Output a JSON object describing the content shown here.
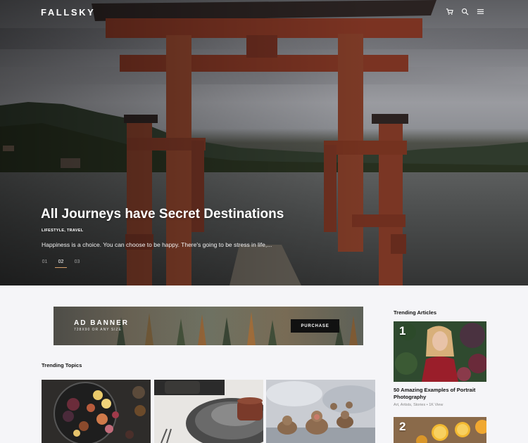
{
  "header": {
    "logo": "FALLSKY",
    "icons": [
      "cart-icon",
      "search-icon",
      "menu-icon"
    ]
  },
  "hero": {
    "title": "All Journeys have Secret Destinations",
    "categories": "LIFESTYLE, TRAVEL",
    "excerpt": "Happiness is a choice. You can choose to be happy. There's going to be stress in life,...",
    "slides": [
      "01",
      "02",
      "03"
    ],
    "active_slide": "02"
  },
  "ad": {
    "title": "AD BANNER",
    "subtitle": "728X90 OR ANY SIZE",
    "button": "PURCHASE"
  },
  "trending_topics": {
    "title": "Trending Topics"
  },
  "trending_articles": {
    "title": "Trending Articles",
    "items": [
      {
        "number": "1",
        "title": "50 Amazing Examples of Portrait Photography",
        "meta": "Art, Artists, Stories  •  1K View"
      },
      {
        "number": "2"
      }
    ]
  },
  "colors": {
    "accent": "#d7a06a",
    "background": "#f5f5f8",
    "button": "#111111"
  }
}
